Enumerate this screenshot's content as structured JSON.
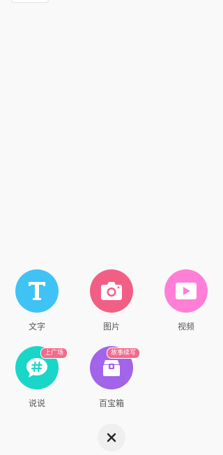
{
  "menu": {
    "items": [
      {
        "label": "文字",
        "color": "#3fc3f5",
        "icon": "text-T-icon"
      },
      {
        "label": "图片",
        "color": "#f25f85",
        "icon": "camera-icon"
      },
      {
        "label": "视频",
        "color": "#ff7fd7",
        "icon": "play-video-icon"
      },
      {
        "label": "说说",
        "color": "#19d6c8",
        "icon": "hashtag-chat-icon",
        "badge": "上广场"
      },
      {
        "label": "百宝箱",
        "color": "#a264e8",
        "icon": "treasure-box-icon",
        "badge": "故事续写"
      }
    ]
  },
  "close": {
    "icon": "close-icon"
  }
}
